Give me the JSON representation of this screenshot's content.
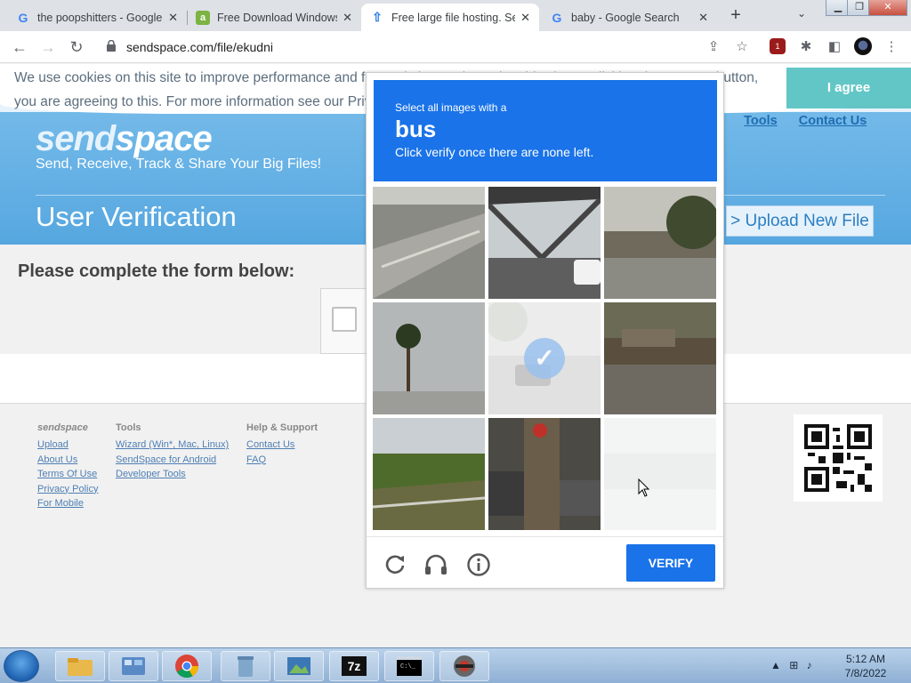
{
  "browser": {
    "tabs": [
      {
        "title": "the poopshitters - Google",
        "favicon": "google-icon",
        "active": false
      },
      {
        "title": "Free Download Windows",
        "favicon": "android-app-icon",
        "active": false
      },
      {
        "title": "Free large file hosting. Se",
        "favicon": "upload-arrow-icon",
        "active": true
      },
      {
        "title": "baby - Google Search",
        "favicon": "google-icon",
        "active": false
      }
    ],
    "url": "sendspace.com/file/ekudni",
    "extension_badge": "1"
  },
  "cookie_banner": {
    "line1": "We use cookies on this site to improve performance and for analytics. By browsing this site, or clicking the 'I agree' button,",
    "line2": "you are agreeing to this. For more information see our Privacy Policy",
    "agree_label": "I agree"
  },
  "site": {
    "logo_part1": "send",
    "logo_part2": "space",
    "tagline": "Send, Receive, Track & Share Your Big Files!",
    "nav_partial": "s",
    "nav_tools": "Tools",
    "nav_contact": "Contact Us",
    "page_title": "User Verification",
    "upload_label": "> Upload New File",
    "form_heading": "Please complete the form below:"
  },
  "captcha": {
    "instruction_line1": "Select all images with a",
    "keyword": "bus",
    "instruction_line2": "Click verify once there are none left.",
    "verify_label": "VERIFY",
    "tiles_selected": [
      false,
      false,
      false,
      false,
      true,
      false,
      false,
      false,
      false
    ],
    "tiles_loading": [
      false,
      false,
      false,
      false,
      false,
      false,
      false,
      false,
      true
    ]
  },
  "footer": {
    "col1_heading": "sendspace",
    "col1_links": [
      "Upload",
      "About Us",
      "Terms Of Use",
      "Privacy Policy",
      "For Mobile"
    ],
    "col2_heading": "Tools",
    "col2_links": [
      "Wizard (Win*, Mac, Linux)",
      "SendSpace for Android",
      "Developer Tools"
    ],
    "col3_heading": "Help & Support",
    "col3_links": [
      "Contact Us",
      "FAQ"
    ]
  },
  "taskbar": {
    "time": "5:12 AM",
    "date": "7/8/2022"
  },
  "colors": {
    "captcha_blue": "#1a73e8",
    "hero_blue": "#56a7e0",
    "agree_teal": "#63c6c6",
    "link_blue": "#1f6db3"
  }
}
